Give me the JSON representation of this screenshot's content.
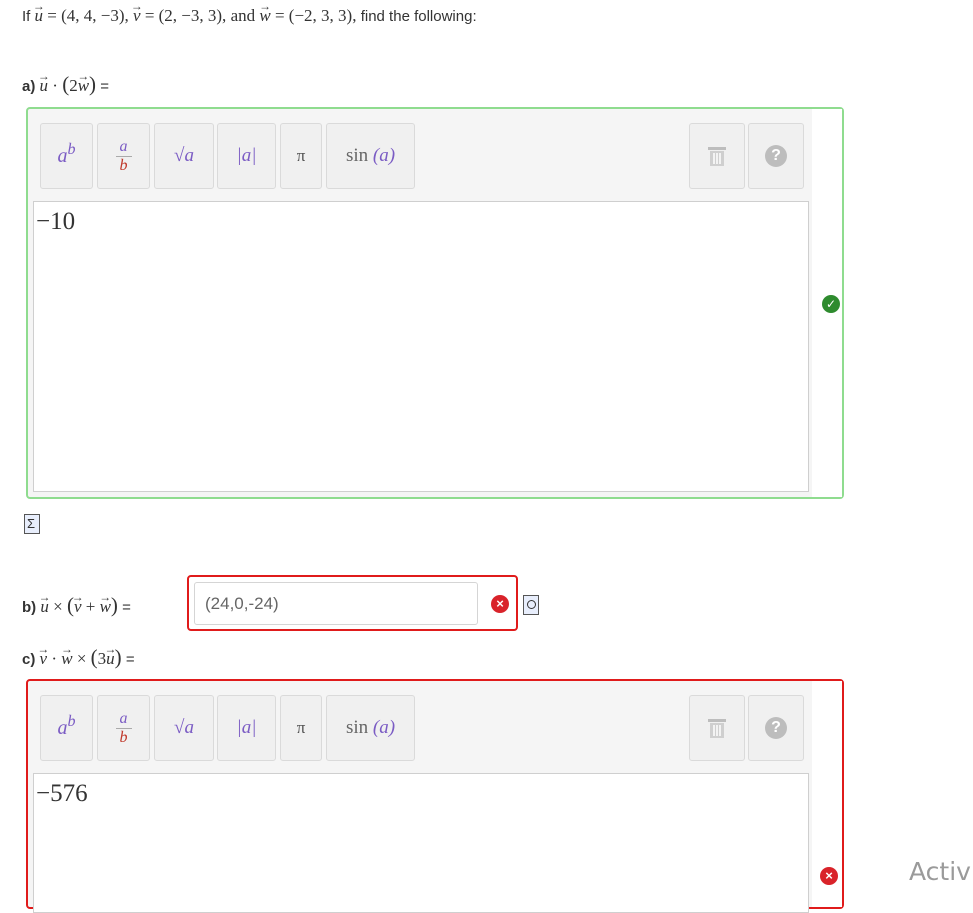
{
  "prompt": {
    "if_label": "If",
    "u_name": "u",
    "u_value": "= (4, 4, −3),",
    "v_name": "v",
    "v_value": "= (2, −3, 3),",
    "and_label": "and",
    "w_name": "w",
    "w_value": "= (−2, 3, 3),",
    "suffix": "find the following:"
  },
  "part_a": {
    "letter": "a)",
    "expr_dot": "·",
    "expr_two": "2",
    "equals": "=",
    "answer": "−10",
    "status": "correct"
  },
  "part_b": {
    "letter": "b)",
    "cross": "×",
    "plus": "+",
    "equals": "=",
    "answer": "(24,0,-24)",
    "status": "incorrect"
  },
  "part_c": {
    "letter": "c)",
    "dot": "·",
    "cross": "×",
    "three": "3",
    "equals": "=",
    "answer": "−576",
    "status": "incorrect"
  },
  "toolbar": {
    "power_base": "a",
    "power_exp": "b",
    "frac_num": "a",
    "frac_den": "b",
    "sqrt_label": "√a",
    "abs_label": "|a|",
    "pi_label": "π",
    "sin_label": "sin",
    "sin_arg": "(a)",
    "help_label": "?"
  },
  "watermark": "Activ",
  "icons": {
    "correct": "check-circle-icon",
    "incorrect": "x-circle-icon",
    "trash": "trash-icon",
    "help": "help-icon",
    "sigma": "sigma-doc-icon",
    "preview": "magnify-doc-icon"
  },
  "colors": {
    "correct_border": "#8fdc8f",
    "incorrect_border": "#e01b1b",
    "correct_icon": "#2e8b2e",
    "incorrect_icon": "#d9232a",
    "toolbar_accent": "#7b5cc4"
  }
}
